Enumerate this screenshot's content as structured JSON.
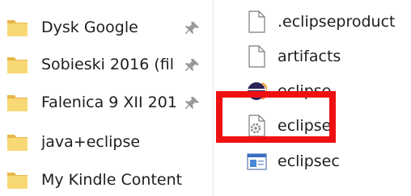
{
  "nav": {
    "items": [
      {
        "label": "Dysk Google",
        "pinned": true
      },
      {
        "label": "Sobieski 2016 (fil",
        "pinned": true
      },
      {
        "label": "Falenica 9 XII 201",
        "pinned": true
      },
      {
        "label": "java+eclipse",
        "pinned": false
      },
      {
        "label": "My Kindle Content",
        "pinned": false
      }
    ],
    "icon": "folder-icon",
    "pin_icon": "pin-icon"
  },
  "files": {
    "items": [
      {
        "label": ".eclipseproduct",
        "icon": "blank-file-icon"
      },
      {
        "label": "artifacts",
        "icon": "blank-file-icon"
      },
      {
        "label": "eclipse",
        "icon": "eclipse-app-icon"
      },
      {
        "label": "eclipse",
        "icon": "config-file-icon"
      },
      {
        "label": "eclipsec",
        "icon": "console-app-icon"
      }
    ]
  },
  "colors": {
    "highlight": "#ee1111",
    "folder": "#f8d775",
    "folder_dark": "#e8b74a",
    "text": "#1e1e1e"
  }
}
